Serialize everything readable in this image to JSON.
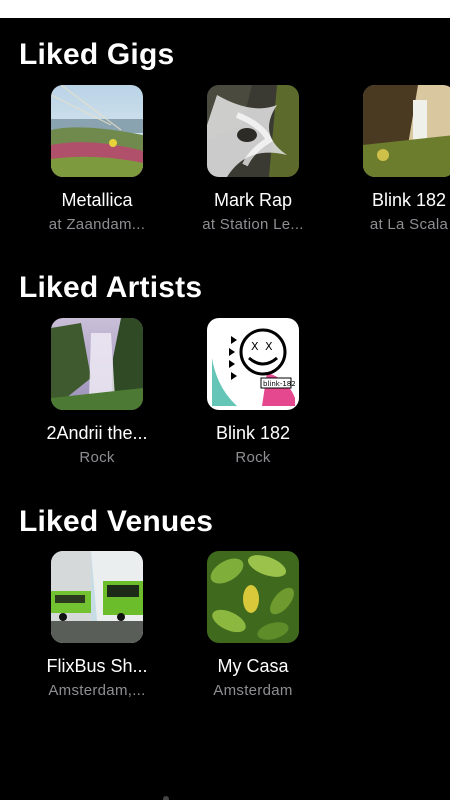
{
  "sections": {
    "gigs": {
      "title": "Liked Gigs",
      "items": [
        {
          "title": "Metallica",
          "subtitle": "at Zaandam...",
          "image": "beach-grass-photo"
        },
        {
          "title": "Mark Rap",
          "subtitle": "at Station Le...",
          "image": "waterfall-rocks-photo"
        },
        {
          "title": "Blink 182",
          "subtitle": "at La Scala",
          "image": "cliff-waterfall-photo"
        }
      ]
    },
    "artists": {
      "title": "Liked Artists",
      "items": [
        {
          "title": "2Andrii the...",
          "subtitle": "Rock",
          "image": "misty-waterfall-photo"
        },
        {
          "title": "Blink 182",
          "subtitle": "Rock",
          "image": "blink182-smiley-art"
        }
      ]
    },
    "venues": {
      "title": "Liked Venues",
      "items": [
        {
          "title": "FlixBus Sh...",
          "subtitle": "Amsterdam,...",
          "image": "green-buses-photo"
        },
        {
          "title": "My Casa",
          "subtitle": "Amsterdam",
          "image": "green-leaves-photo"
        }
      ]
    }
  }
}
